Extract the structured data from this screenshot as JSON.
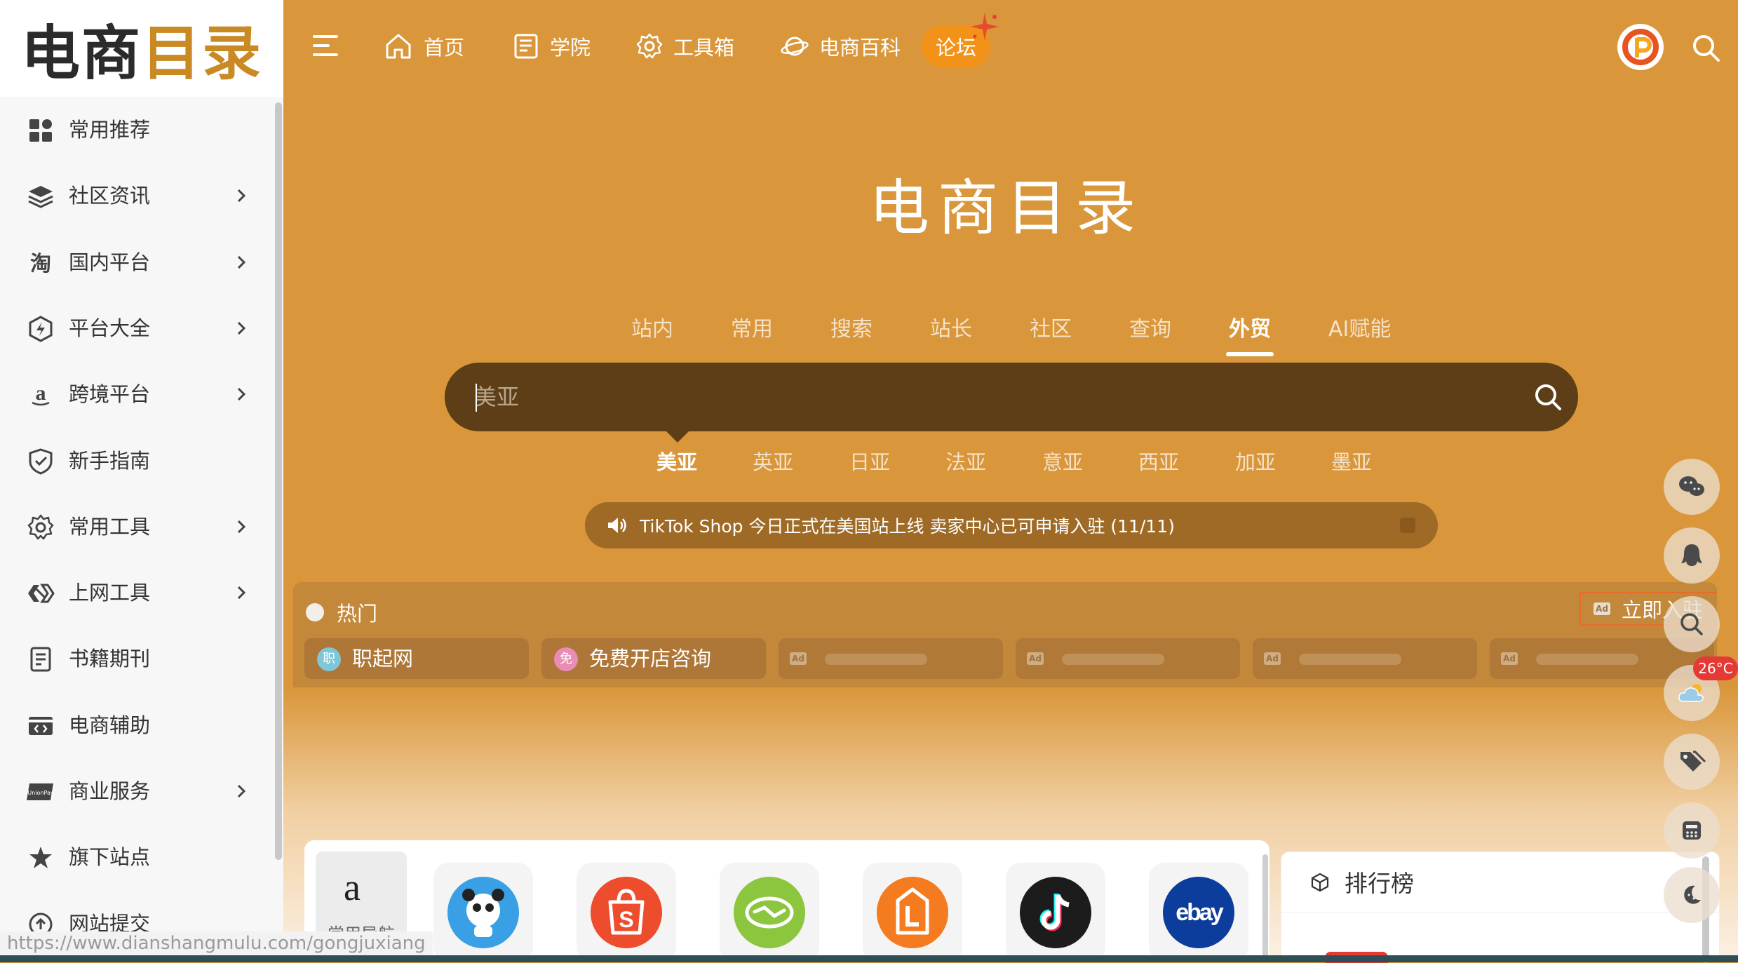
{
  "logo": {
    "part1": "电商",
    "part2": "目录"
  },
  "sidebar": {
    "items": [
      {
        "label": "常用推荐",
        "icon": "grid-icon",
        "chevron": false
      },
      {
        "label": "社区资讯",
        "icon": "layers-icon",
        "chevron": true
      },
      {
        "label": "国内平台",
        "icon": "taobao-icon",
        "chevron": true
      },
      {
        "label": "平台大全",
        "icon": "hexagon-bolt-icon",
        "chevron": true
      },
      {
        "label": "跨境平台",
        "icon": "amazon-icon",
        "chevron": true
      },
      {
        "label": "新手指南",
        "icon": "shield-check-icon",
        "chevron": false
      },
      {
        "label": "常用工具",
        "icon": "gear-icon",
        "chevron": true
      },
      {
        "label": "上网工具",
        "icon": "vpn-icon",
        "chevron": true
      },
      {
        "label": "书籍期刊",
        "icon": "document-icon",
        "chevron": false
      },
      {
        "label": "电商辅助",
        "icon": "code-card-icon",
        "chevron": false
      },
      {
        "label": "商业服务",
        "icon": "unionpay-icon",
        "chevron": true
      },
      {
        "label": "旗下站点",
        "icon": "star-badge-icon",
        "chevron": false
      },
      {
        "label": "网站提交",
        "icon": "upload-icon",
        "chevron": false
      }
    ]
  },
  "topnav": {
    "items": [
      {
        "label": "首页",
        "icon": "home-icon"
      },
      {
        "label": "学院",
        "icon": "book-icon"
      },
      {
        "label": "工具箱",
        "icon": "gear-icon"
      },
      {
        "label": "电商百科",
        "icon": "planet-icon"
      }
    ],
    "forum": "论坛"
  },
  "hero": {
    "title": "电商目录"
  },
  "search": {
    "tabs": [
      "站内",
      "常用",
      "搜索",
      "站长",
      "社区",
      "查询",
      "外贸",
      "AI赋能"
    ],
    "active_tab": "外贸",
    "placeholder": "美亚",
    "subtabs": [
      "美亚",
      "英亚",
      "日亚",
      "法亚",
      "意亚",
      "西亚",
      "加亚",
      "墨亚"
    ],
    "active_subtab": "美亚"
  },
  "notice": {
    "text": "TikTok Shop 今日正式在美国站上线 卖家中心已可申请入驻 (11/11)"
  },
  "hot": {
    "title": "热门",
    "join_label": "立即入驻",
    "ad_label": "Ad",
    "chips": [
      {
        "label": "职起网",
        "icon_text": "职",
        "color": "#7fc6d6"
      },
      {
        "label": "免费开店咨询",
        "icon_text": "免",
        "color": "#e98db4"
      }
    ]
  },
  "weather": {
    "temp": "26°C"
  },
  "nav_panel": {
    "category": "常用导航",
    "apps": [
      {
        "name": "panda-app-icon",
        "color": "#3aa0e6"
      },
      {
        "name": "shopee-icon",
        "color": "#ee4d2d"
      },
      {
        "name": "handshake-icon",
        "color": "#8cc63f"
      },
      {
        "name": "lazada-icon",
        "color": "#f47b20"
      },
      {
        "name": "tiktok-icon",
        "color": "#1c1c1c"
      },
      {
        "name": "ebay-icon",
        "color": "#0c3d9c"
      }
    ],
    "ebay_text": "ebay"
  },
  "rank": {
    "title": "排行榜"
  },
  "status": {
    "url": "https://www.dianshangmulu.com/gongjuxiang"
  }
}
